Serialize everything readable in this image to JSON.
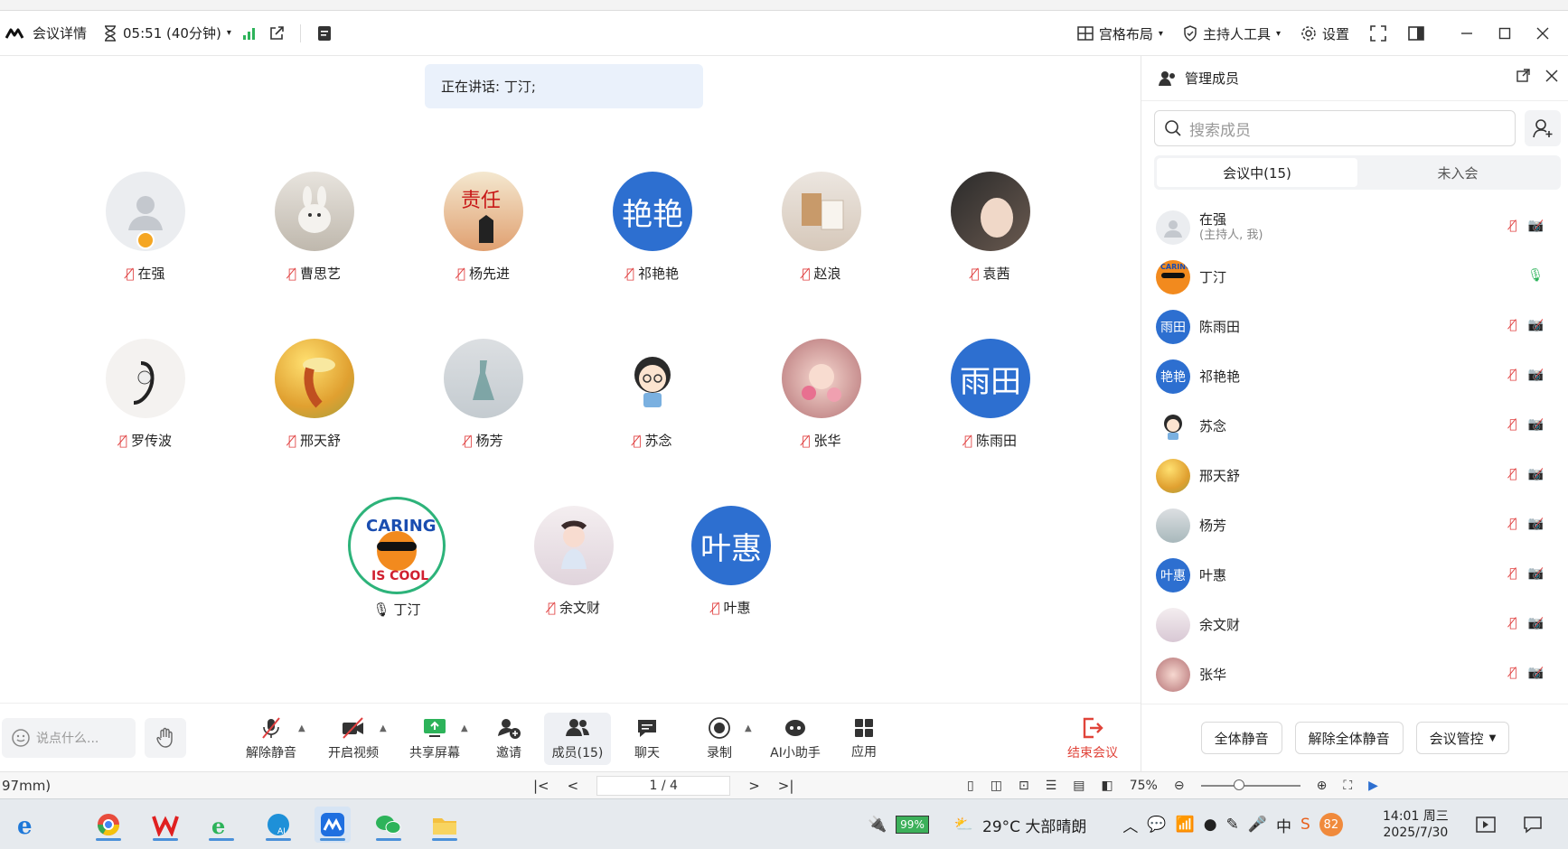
{
  "titlebar": {
    "meeting_details": "会议详情",
    "timer": "05:51 (40分钟)",
    "layout": "宫格布局",
    "host_tools": "主持人工具",
    "settings": "设置"
  },
  "stage": {
    "speaking": "正在讲话: 丁汀;",
    "participants": [
      {
        "name": "在强",
        "initials": ""
      },
      {
        "name": "曹思艺",
        "initials": ""
      },
      {
        "name": "杨先进",
        "initials": ""
      },
      {
        "name": "祁艳艳",
        "initials": "艳艳"
      },
      {
        "name": "赵浪",
        "initials": ""
      },
      {
        "name": "袁茜",
        "initials": ""
      },
      {
        "name": "罗传波",
        "initials": ""
      },
      {
        "name": "邢天舒",
        "initials": ""
      },
      {
        "name": "杨芳",
        "initials": ""
      },
      {
        "name": "苏念",
        "initials": ""
      },
      {
        "name": "张华",
        "initials": ""
      },
      {
        "name": "陈雨田",
        "initials": "雨田"
      },
      {
        "name": "丁汀",
        "initials": ""
      },
      {
        "name": "余文财",
        "initials": ""
      },
      {
        "name": "叶惠",
        "initials": "叶惠"
      }
    ]
  },
  "toolbar": {
    "chat_placeholder": "说点什么...",
    "unmute": "解除静音",
    "start_video": "开启视频",
    "share_screen": "共享屏幕",
    "invite": "邀请",
    "members": "成员(15)",
    "chat": "聊天",
    "record": "录制",
    "ai_assistant": "AI小助手",
    "apps": "应用",
    "end_meeting": "结束会议"
  },
  "panel": {
    "title": "管理成员",
    "search_placeholder": "搜索成员",
    "tab_in_meeting": "会议中(15)",
    "tab_not_joined": "未入会",
    "members": [
      {
        "name": "在强",
        "sub": "(主持人, 我)",
        "initials": ""
      },
      {
        "name": "丁汀",
        "sub": "",
        "initials": ""
      },
      {
        "name": "陈雨田",
        "sub": "",
        "initials": "雨田"
      },
      {
        "name": "祁艳艳",
        "sub": "",
        "initials": "艳艳"
      },
      {
        "name": "苏念",
        "sub": "",
        "initials": ""
      },
      {
        "name": "邢天舒",
        "sub": "",
        "initials": ""
      },
      {
        "name": "杨芳",
        "sub": "",
        "initials": ""
      },
      {
        "name": "叶惠",
        "sub": "",
        "initials": "叶惠"
      },
      {
        "name": "余文财",
        "sub": "",
        "initials": ""
      },
      {
        "name": "张华",
        "sub": "",
        "initials": ""
      }
    ],
    "mute_all": "全体静音",
    "unmute_all": "解除全体静音",
    "meeting_control": "会议管控"
  },
  "viewer": {
    "left_text": "97mm)",
    "page": "1 / 4",
    "zoom": "75%"
  },
  "taskbar": {
    "battery": "99%",
    "weather": "29°C  大部晴朗",
    "ime": "中",
    "badge": "82",
    "time": "14:01 周三",
    "date": "2025/7/30"
  }
}
